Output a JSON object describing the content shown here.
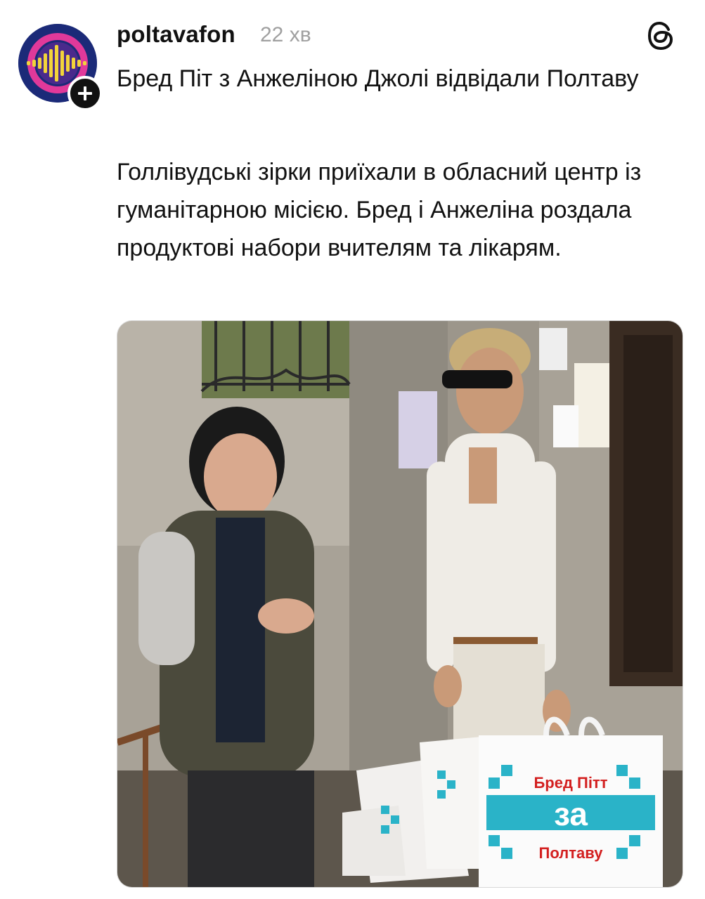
{
  "post": {
    "username": "poltavafon",
    "timestamp": "22 хв",
    "headline": "Бред Піт з Анжеліною Джолі відвідали Полтаву",
    "body": "Голлівудські зірки приїхали в обласний центр із гуманітарною місією. Бред і Анжеліна роздала продуктові набори вчителям та лікарям."
  },
  "photo": {
    "bag_line_1": "Бред Пітт",
    "bag_line_2": "за",
    "bag_line_3": "Полтаву"
  },
  "icons": {
    "avatar": "podcast-soundwave-logo",
    "follow": "plus-icon",
    "app": "threads-logo-icon"
  },
  "colors": {
    "avatar_bg": "#1b2a78",
    "avatar_ring": "#e0399a",
    "avatar_wave": "#f2d43a",
    "timestamp": "#a0a0a0",
    "bag_teal": "#2ab3c8",
    "bag_red": "#d32020"
  }
}
